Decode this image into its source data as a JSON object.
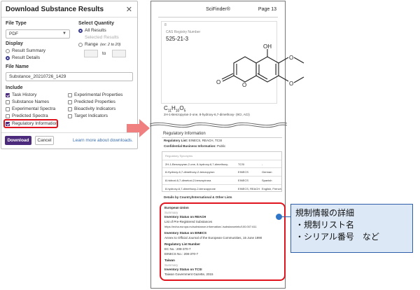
{
  "dialog": {
    "title": "Download Substance Results",
    "close_glyph": "✕",
    "file_type_label": "File Type",
    "file_type_value": "PDF",
    "select_quantity_label": "Select Quantity",
    "quantity_options": [
      "All Results",
      "Selected Results",
      "Range"
    ],
    "range_hint": "(ex: 2 to 20)",
    "range_to": "to",
    "display_label": "Display",
    "display_options": [
      "Result Summary",
      "Result Details"
    ],
    "file_name_label": "File Name",
    "file_name_value": "Substance_20210726_1429",
    "include_label": "Include",
    "include_left": [
      "Task History",
      "Substance Names",
      "Experimental Spectra",
      "Predicted Spectra",
      "Regulatory Information"
    ],
    "include_right": [
      "Experimental Properties",
      "Predicted Properties",
      "Bioactivity Indicators",
      "Target Indicators"
    ],
    "download_label": "Download",
    "cancel_label": "Cancel",
    "learn_more": "Learn more about downloads."
  },
  "document": {
    "app": "SciFinder®",
    "page": "Page 13",
    "record_number": "8",
    "cas_label": "CAS Registry Number",
    "cas_number": "525-21-3",
    "atom_oh": "OH",
    "atom_o": "O",
    "formula_c": "C",
    "formula_c_sub": "11",
    "formula_h": "H",
    "formula_h_sub": "10",
    "formula_o": "O",
    "formula_o_sub": "5",
    "chem_name": "2H-1-Benzopyran-2-one, 8-hydroxy-6,7-dimethoxy- (9CI, ACI)",
    "ri_title": "Regulatory Information",
    "reg_list_label": "Regulatory List:",
    "reg_list_value": "EINECS, REACH, TCSI",
    "cbi_label": "Confidential Business Information:",
    "cbi_value": "Public",
    "synonyms_header": "Regulatory Synonyms",
    "synonyms": [
      [
        "2H-1-Benzopyran-2-one, 8-hydroxy-6,7-dimethoxy-",
        "TCSI",
        "-"
      ],
      [
        "8-Hydroxy-6,7-dimethoxy-2-benzopyron",
        "EINECS",
        "German"
      ],
      [
        "8-hidroxi-6,7-dimetoxi-2-benzopirona",
        "EINECS",
        "Spanish"
      ],
      [
        "8-hydroxy-6,7-dimethoxy-2-benzopyrone",
        "EINECS, REACH",
        "English, French"
      ]
    ],
    "details_label": "Details by Country/International & Other Lists",
    "eu_region": "European Union",
    "eu_summary": "Summary",
    "reach_title": "Inventory Status on REACH",
    "reach_text": "List of Pre-Registered Substances",
    "reach_url": "https://echa.europa.eu/substance-information/-/substanceinfo/100.007.611",
    "einecs_title": "Inventory Status on EINECS",
    "einecs_text": "Annex to Official Journal of the European Communities, 15 June 1990",
    "reg_num_title": "Regulatory List Number",
    "ec_no": "EC No.: 208-370-7",
    "einecs_no": "EINECS No.: 208-370-7",
    "taiwan_region": "Taiwan",
    "taiwan_summary": "Summary",
    "tcsi_title": "Inventory Status on TCSI",
    "tcsi_text": "Taiwan Government Gazette, 2015"
  },
  "callout": {
    "line1": "規制情報の詳細",
    "line2": "・規制リスト名",
    "line3": "・シリアル番号　など"
  },
  "colors": {
    "accent_purple": "#4b2a7c",
    "highlight_red": "#e0141e",
    "arrow_pink": "#f08080",
    "callout_blue": "#2f5fa8",
    "callout_fill": "#dce8f6"
  }
}
